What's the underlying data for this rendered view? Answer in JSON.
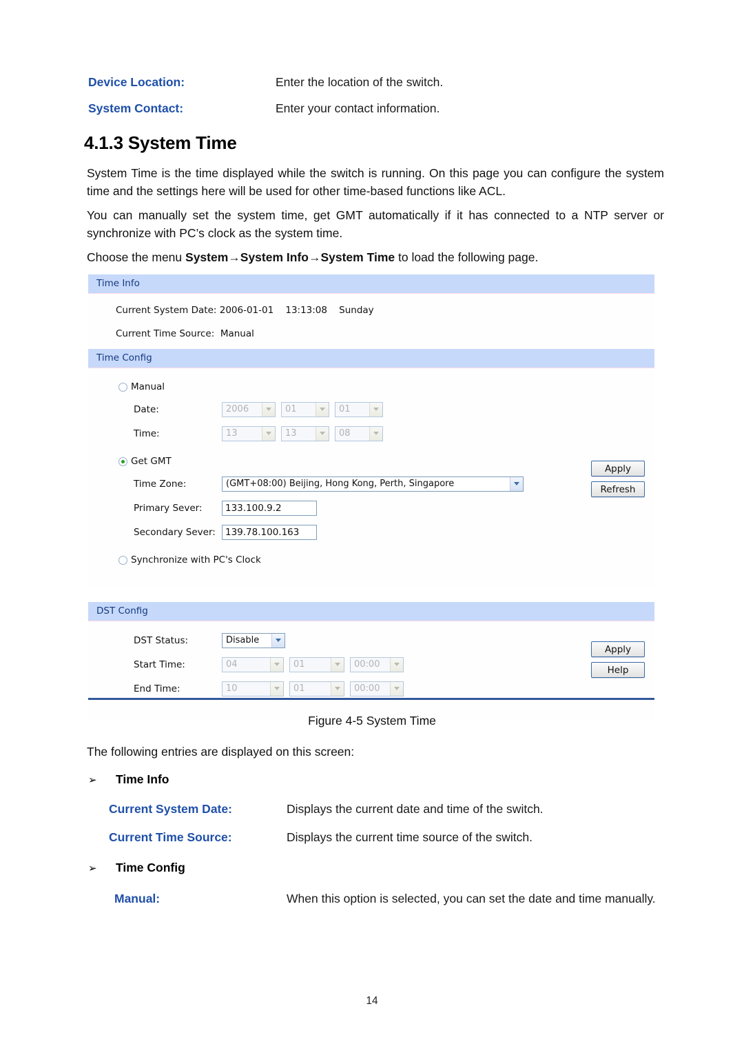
{
  "top_definitions": [
    {
      "term": "Device Location:",
      "desc": "Enter the location of the switch."
    },
    {
      "term": "System Contact:",
      "desc": "Enter your contact information."
    }
  ],
  "section": {
    "number": "4.1.3",
    "title": "System Time",
    "heading": "4.1.3 System Time"
  },
  "paragraphs": {
    "p1": "System Time is the time displayed while the switch is running. On this page you can configure the system time and the settings here will be used for other time-based functions like ACL.",
    "p2": "You can manually set the system time, get GMT automatically if it has connected to a NTP server or synchronize with PC’s clock as the system time.",
    "p3_prefix": "Choose the menu ",
    "p3_bold": "System→System Info→System Time",
    "p3_suffix": " to load the following page.",
    "after_figure": "The following entries are displayed on this screen:"
  },
  "screenshot": {
    "time_info": {
      "header": "Time Info",
      "current_system_date_label": "Current System Date:",
      "current_system_date_value": "2006-01-01    13:13:08    Sunday",
      "current_system_date_line": "Current System Date: 2006-01-01    13:13:08    Sunday",
      "current_time_source_label": "Current Time Source:",
      "current_time_source_value": "Manual",
      "current_time_source_line": "Current Time Source:  Manual"
    },
    "time_config": {
      "header": "Time Config",
      "manual": {
        "radio_label": "Manual",
        "selected": false,
        "date_label": "Date:",
        "date_year": "2006",
        "date_month": "01",
        "date_day": "01",
        "time_label": "Time:",
        "time_hour": "13",
        "time_minute": "13",
        "time_second": "08"
      },
      "get_gmt": {
        "radio_label": "Get GMT",
        "selected": true,
        "timezone_label": "Time Zone:",
        "timezone_value": "(GMT+08:00) Beijing, Hong Kong, Perth, Singapore",
        "primary_label": "Primary Sever:",
        "primary_value": "133.100.9.2",
        "secondary_label": "Secondary Sever:",
        "secondary_value": "139.78.100.163"
      },
      "sync_pc": {
        "radio_label": "Synchronize with PC's Clock",
        "selected": false
      },
      "apply_label": "Apply",
      "refresh_label": "Refresh"
    },
    "dst_config": {
      "header": "DST Config",
      "dst_status_label": "DST Status:",
      "dst_status_value": "Disable",
      "start_time_label": "Start Time:",
      "start_month": "04",
      "start_day": "01",
      "start_clock": "00:00",
      "end_time_label": "End Time:",
      "end_month": "10",
      "end_day": "01",
      "end_clock": "00:00",
      "apply_label": "Apply",
      "help_label": "Help"
    }
  },
  "figure_caption": "Figure 4-5 System Time",
  "bullets": {
    "arrow": "➢",
    "time_info": "Time Info",
    "time_config": "Time Config"
  },
  "bottom_definitions": [
    {
      "term": "Current System Date:",
      "desc": "Displays the current date and time of the switch."
    },
    {
      "term": "Current Time Source:",
      "desc": "Displays the current time source of the switch."
    }
  ],
  "manual_definition": {
    "term": "Manual:",
    "desc": "When  this  option  is  selected,  you  can  set  the  date  and  time manually."
  },
  "page_number": "14",
  "colors": {
    "term_blue": "#1f4fa8",
    "panel_header_bg": "#c6d9fb",
    "panel_header_text": "#15387e",
    "rule_blue": "#31589c",
    "radio_green": "#20a020"
  }
}
